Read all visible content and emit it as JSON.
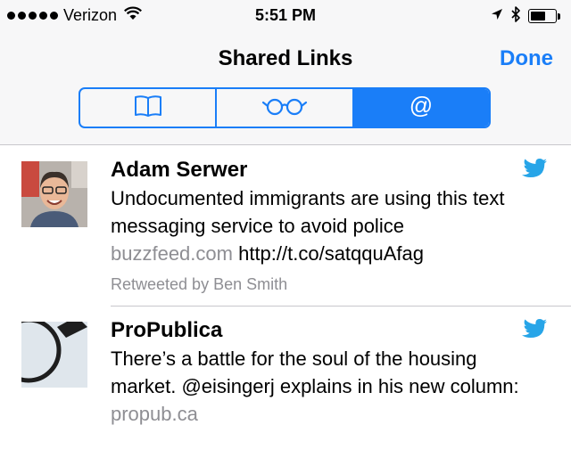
{
  "status_bar": {
    "carrier": "Verizon",
    "time": "5:51 PM",
    "battery_level": 0.6
  },
  "nav": {
    "title": "Shared Links",
    "done_label": "Done"
  },
  "segments": [
    {
      "icon": "book-icon",
      "selected": false
    },
    {
      "icon": "glasses-icon",
      "selected": false
    },
    {
      "icon": "at-sign-icon",
      "label": "@",
      "selected": true
    }
  ],
  "colors": {
    "accent": "#1a7ef8",
    "twitter": "#27a5e8",
    "secondary_text": "#8e8e93"
  },
  "items": [
    {
      "author": "Adam Serwer",
      "text_line1": "Undocumented immigrants are using this text",
      "text_line2": "messaging service to avoid police",
      "domain": "buzzfeed.com",
      "url": "http://t.co/satqquAfag",
      "retweeted_by": "Retweeted by Ben Smith",
      "source_icon": "twitter-bird-icon"
    },
    {
      "author": "ProPublica",
      "text_line1": "There’s a battle for the soul of the housing",
      "text_line2": "market. @eisingerj explains in his new column:",
      "domain": "propub.ca",
      "source_icon": "twitter-bird-icon"
    }
  ]
}
